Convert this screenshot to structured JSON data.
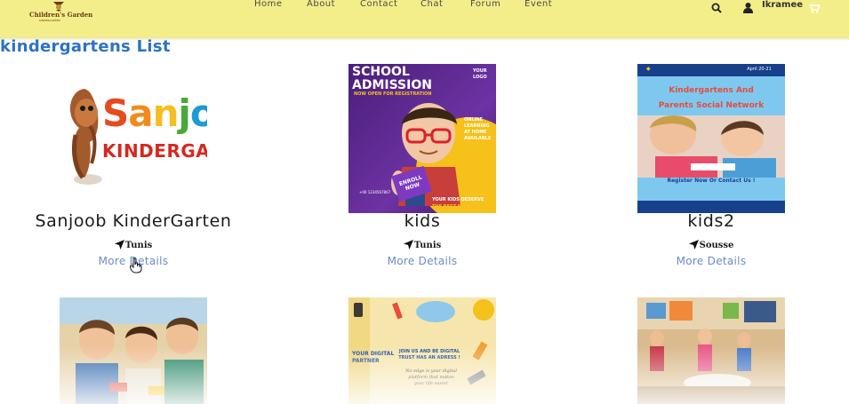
{
  "header": {
    "logo_text": "Children's Garden",
    "logo_subtext": "KINDERGARTEN",
    "nav": [
      "Home",
      "About",
      "Contact",
      "Chat",
      "Forum",
      "Event"
    ],
    "username": "Ikramee",
    "icons": [
      "search-icon",
      "user-icon",
      "cart-icon"
    ]
  },
  "page": {
    "title": "kindergartens List"
  },
  "cards": [
    {
      "name": "Sanjoob KinderGarten",
      "location": "Tunis",
      "more": "More Details",
      "logo_line1": "Sanjoob",
      "logo_line2": "KINDERGARTEN"
    },
    {
      "name": "kids",
      "location": "Tunis",
      "more": "More Details",
      "poster_title": "SCHOOL ADMISSION",
      "poster_sub": "NOW OPEN FOR REGISTRATION",
      "poster_logo": "YOUR LOGO",
      "poster_online": "ONLINE LEARNING AT HOME AVAILABLE",
      "poster_enroll": "ENROLL NOW",
      "poster_phone": "+00 1234567867",
      "poster_footer1": "YOUR KIDS DESERVE",
      "poster_footer2": "THE BEST EDUCATION"
    },
    {
      "name": "kids2",
      "location": "Sousse",
      "more": "More Details",
      "poster_title": "Kindergartens And Parents Social Network",
      "poster_date": "April 20-21",
      "poster_register": "Register Now Or Contact Us !"
    }
  ],
  "row2": {
    "card2_headline": "JOIN US AND BE DIGITAL TRUST HAS AN ADRESS !",
    "card2_side": "YOUR DIGITAL PARTNER",
    "card2_body": "No edge is your digital platform that makes your life easier"
  },
  "colors": {
    "header_bg": "#f3ee8a",
    "title": "#2c73c4",
    "link": "#6a8cc7"
  }
}
